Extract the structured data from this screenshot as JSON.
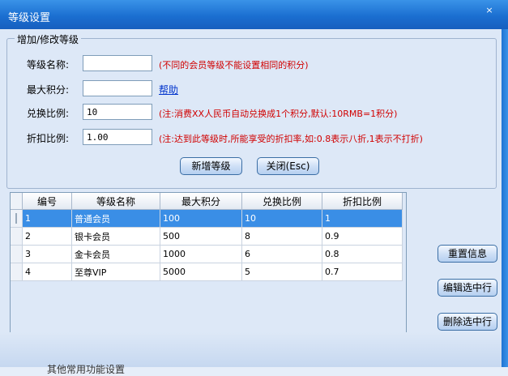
{
  "window": {
    "title": "等级设置",
    "close_glyph": "×"
  },
  "group": {
    "legend": "增加/修改等级"
  },
  "form": {
    "name_label": "等级名称:",
    "name_value": "",
    "name_note": "(不同的会员等级不能设置相同的积分)",
    "maxscore_label": "最大积分:",
    "maxscore_value": "",
    "help_link": "帮助",
    "ratio_label": "兑换比例:",
    "ratio_value": "10",
    "ratio_note": "(注:消费XX人民币自动兑换成1个积分,默认:10RMB=1积分)",
    "discount_label": "折扣比例:",
    "discount_value": "1.00",
    "discount_note": "(注:达到此等级时,所能享受的折扣率,如:0.8表示八折,1表示不打折)"
  },
  "buttons": {
    "add": "新增等级",
    "close": "关闭(Esc)",
    "reset": "重置信息",
    "edit": "编辑选中行",
    "delete": "删除选中行"
  },
  "table": {
    "columns": [
      "编号",
      "等级名称",
      "最大积分",
      "兑换比例",
      "折扣比例"
    ],
    "rows": [
      [
        "1",
        "普通会员",
        "100",
        "10",
        "1"
      ],
      [
        "2",
        "银卡会员",
        "500",
        "8",
        "0.9"
      ],
      [
        "3",
        "金卡会员",
        "1000",
        "6",
        "0.8"
      ],
      [
        "4",
        "至尊VIP",
        "5000",
        "5",
        "0.7"
      ]
    ],
    "selected_row": 0
  },
  "footer": {
    "partial_text": "其他常用功能设置"
  },
  "colors": {
    "title_bar": "#1b6fd1",
    "selection": "#3a8ee6",
    "note": "#d10000",
    "link": "#0033cc"
  }
}
